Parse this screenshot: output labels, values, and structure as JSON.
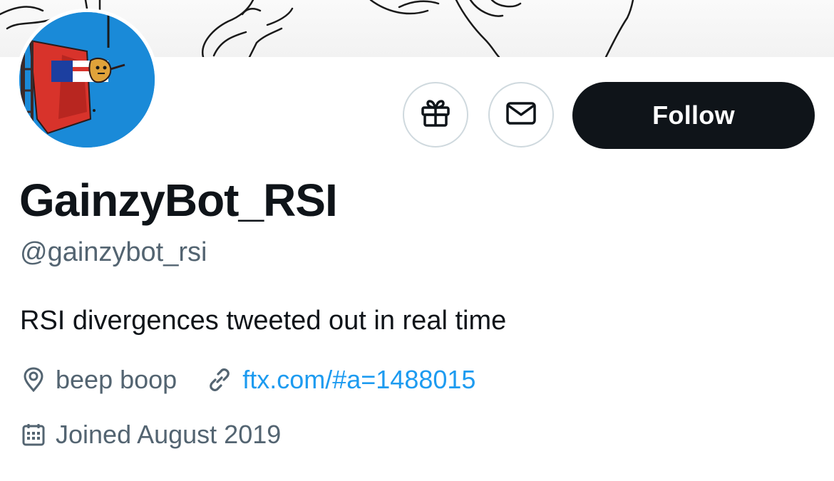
{
  "profile": {
    "display_name": "GainzyBot_RSI",
    "handle": "@gainzybot_rsi",
    "bio": "RSI divergences tweeted out in real time",
    "location": "beep boop",
    "website": "ftx.com/#a=1488015",
    "joined": "Joined August 2019"
  },
  "actions": {
    "follow_label": "Follow",
    "gift_icon": "gift-icon",
    "message_icon": "envelope-icon"
  },
  "colors": {
    "accent": "#1d9bf0",
    "text_primary": "#0f1419",
    "text_secondary": "#536471",
    "border": "#cfd9de",
    "avatar_bg": "#1a8ad8"
  }
}
